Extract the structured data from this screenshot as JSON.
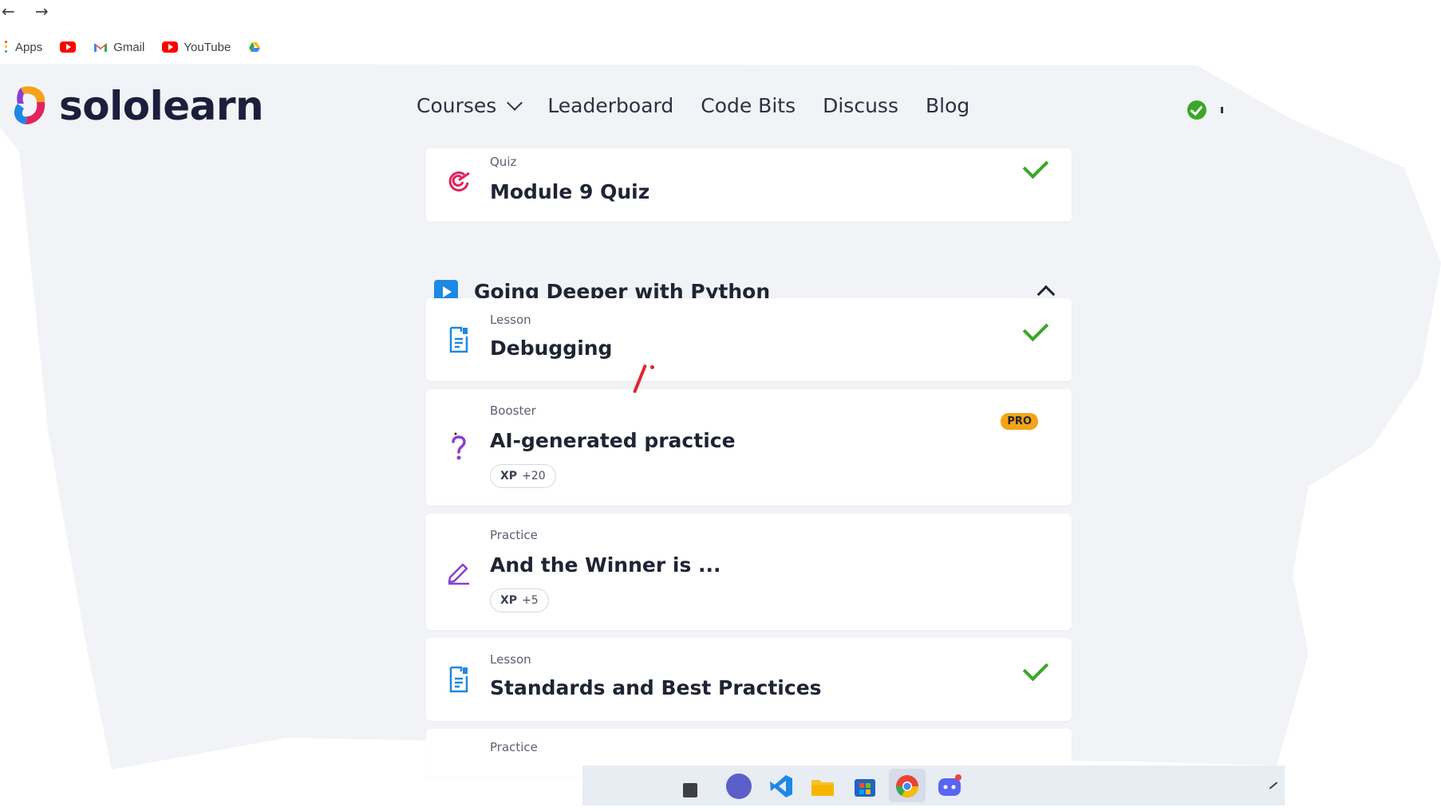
{
  "browser": {
    "back_glyph": "←",
    "forward_glyph": "→",
    "bookmarks": [
      {
        "label": "Apps",
        "icon": "apps-icon"
      },
      {
        "label": "",
        "icon": "youtube-icon"
      },
      {
        "label": "Gmail",
        "icon": "gmail-icon"
      },
      {
        "label": "YouTube",
        "icon": "youtube-icon"
      },
      {
        "label": "",
        "icon": "drive-icon"
      }
    ]
  },
  "header": {
    "logo_text": "sololearn",
    "nav": [
      {
        "label": "Courses",
        "has_dropdown": true
      },
      {
        "label": "Leaderboard"
      },
      {
        "label": "Code Bits"
      },
      {
        "label": "Discuss"
      },
      {
        "label": "Blog"
      }
    ]
  },
  "content": {
    "quiz_card": {
      "type": "Quiz",
      "title": "Module 9 Quiz",
      "completed": true,
      "icon": "target-icon"
    },
    "section": {
      "title": "Going Deeper with Python",
      "expanded": true
    },
    "items": [
      {
        "type": "Lesson",
        "title": "Debugging",
        "completed": true,
        "icon": "lesson-icon"
      },
      {
        "type": "Booster",
        "title": "AI-generated practice",
        "badge": "PRO",
        "xp_label": "XP",
        "xp_value": "+20",
        "icon": "question-icon"
      },
      {
        "type": "Practice",
        "title": "And the Winner is ...",
        "xp_label": "XP",
        "xp_value": "+5",
        "icon": "pencil-icon"
      },
      {
        "type": "Lesson",
        "title": "Standards and Best Practices",
        "completed": true,
        "icon": "lesson-icon"
      },
      {
        "type": "Practice",
        "title": "",
        "icon": "pencil-icon"
      }
    ]
  },
  "colors": {
    "accent_green": "#3aa728",
    "pro_badge": "#f4a417",
    "section_play": "#1e88e5",
    "quiz_icon": "#e0245e",
    "booster_icon": "#8a3fd1",
    "lesson_icon": "#1e88e5"
  }
}
